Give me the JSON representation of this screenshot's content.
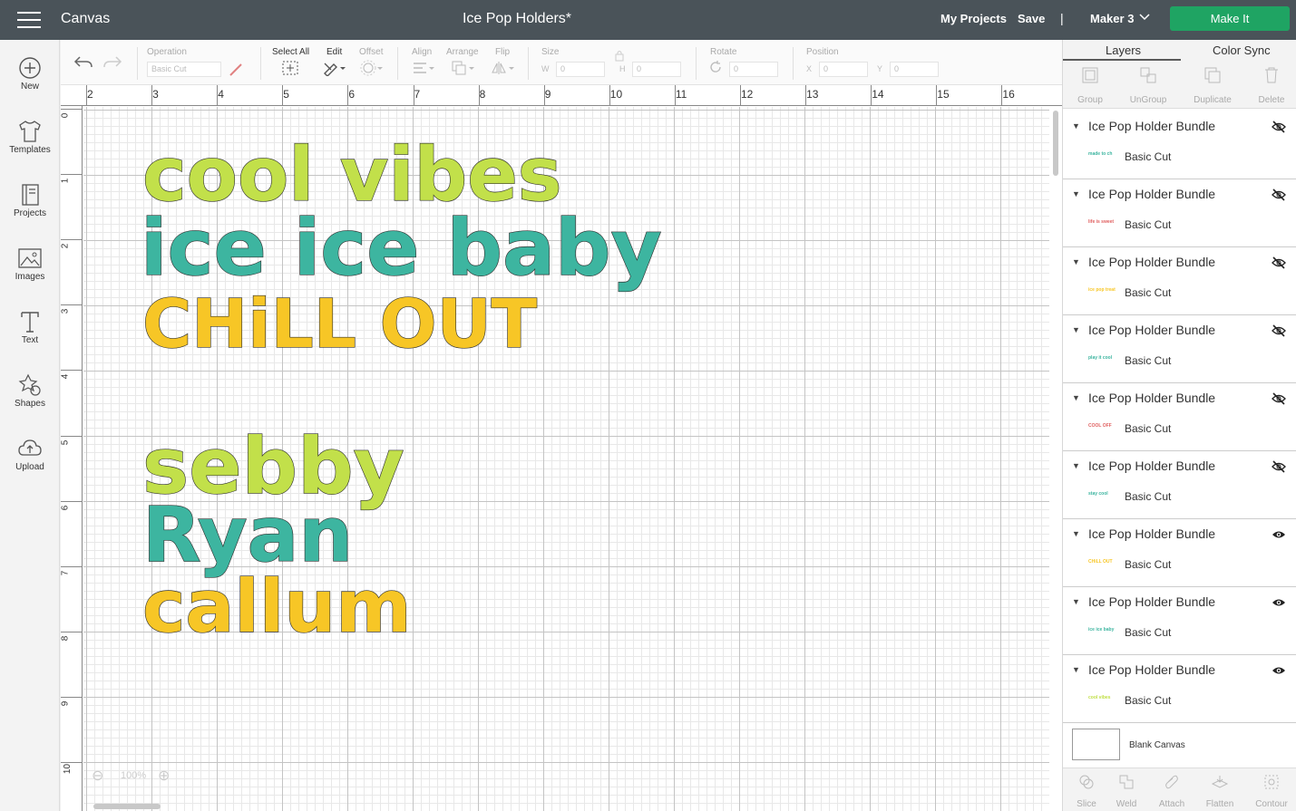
{
  "topbar": {
    "app_title": "Canvas",
    "doc_title": "Ice Pop Holders*",
    "my_projects": "My Projects",
    "save": "Save",
    "divider": "|",
    "machine": "Maker 3",
    "make_it": "Make It"
  },
  "sidebar": {
    "items": [
      {
        "label": "New",
        "icon": "plus-circle-icon"
      },
      {
        "label": "Templates",
        "icon": "tshirt-icon"
      },
      {
        "label": "Projects",
        "icon": "notebook-icon"
      },
      {
        "label": "Images",
        "icon": "image-icon"
      },
      {
        "label": "Text",
        "icon": "text-icon"
      },
      {
        "label": "Shapes",
        "icon": "shapes-icon"
      },
      {
        "label": "Upload",
        "icon": "cloud-upload-icon"
      }
    ]
  },
  "toolbar": {
    "operation_label": "Operation",
    "operation_value": "Basic Cut",
    "select_all": "Select All",
    "edit": "Edit",
    "offset": "Offset",
    "align": "Align",
    "arrange": "Arrange",
    "flip": "Flip",
    "size": "Size",
    "w_label": "W",
    "w_value": "0",
    "h_label": "H",
    "h_value": "0",
    "rotate": "Rotate",
    "rotate_value": "0",
    "position": "Position",
    "x_label": "X",
    "x_value": "0",
    "y_label": "Y",
    "y_value": "0"
  },
  "ruler": {
    "top": [
      "2",
      "3",
      "4",
      "5",
      "6",
      "7",
      "8",
      "9",
      "10",
      "11",
      "12",
      "13",
      "14",
      "15",
      "16"
    ],
    "left": [
      "0",
      "1",
      "2",
      "3",
      "4",
      "5",
      "6",
      "7",
      "8",
      "9",
      "10"
    ]
  },
  "canvas": {
    "texts": [
      {
        "text": "cool vibes",
        "color": "#c2e04a"
      },
      {
        "text": "ice ice baby",
        "color": "#3db5a0"
      },
      {
        "text": "CHiLL OUT",
        "color": "#f7c626"
      },
      {
        "text": "sebby",
        "color": "#c2e04a"
      },
      {
        "text": "Ryan",
        "color": "#3db5a0"
      },
      {
        "text": "callum",
        "color": "#f7c626"
      }
    ],
    "zoom": "100%"
  },
  "panel": {
    "tabs": [
      "Layers",
      "Color Sync"
    ],
    "tools": [
      "Group",
      "UnGroup",
      "Duplicate",
      "Delete"
    ],
    "layers": [
      {
        "title": "Ice Pop Holder Bundle",
        "sub": "Basic Cut",
        "thumb": "made to ch",
        "thumb_color": "#3db5a0",
        "visible": false
      },
      {
        "title": "Ice Pop Holder Bundle",
        "sub": "Basic Cut",
        "thumb": "life is sweet",
        "thumb_color": "#e06060",
        "visible": false
      },
      {
        "title": "Ice Pop Holder Bundle",
        "sub": "Basic Cut",
        "thumb": "ice pop treat",
        "thumb_color": "#f7c626",
        "visible": false
      },
      {
        "title": "Ice Pop Holder Bundle",
        "sub": "Basic Cut",
        "thumb": "play it cool",
        "thumb_color": "#3db5a0",
        "visible": false
      },
      {
        "title": "Ice Pop Holder Bundle",
        "sub": "Basic Cut",
        "thumb": "COOL OFF",
        "thumb_color": "#e06060",
        "visible": false
      },
      {
        "title": "Ice Pop Holder Bundle",
        "sub": "Basic Cut",
        "thumb": "stay cool",
        "thumb_color": "#3db5a0",
        "visible": false
      },
      {
        "title": "Ice Pop Holder Bundle",
        "sub": "Basic Cut",
        "thumb": "CHiLL OUT",
        "thumb_color": "#f7c626",
        "visible": true
      },
      {
        "title": "Ice Pop Holder Bundle",
        "sub": "Basic Cut",
        "thumb": "ice ice baby",
        "thumb_color": "#3db5a0",
        "visible": true
      },
      {
        "title": "Ice Pop Holder Bundle",
        "sub": "Basic Cut",
        "thumb": "cool vibes",
        "thumb_color": "#c2e04a",
        "visible": true
      }
    ],
    "blank_canvas": "Blank Canvas",
    "bottom_tools": [
      "Slice",
      "Weld",
      "Attach",
      "Flatten",
      "Contour"
    ]
  }
}
